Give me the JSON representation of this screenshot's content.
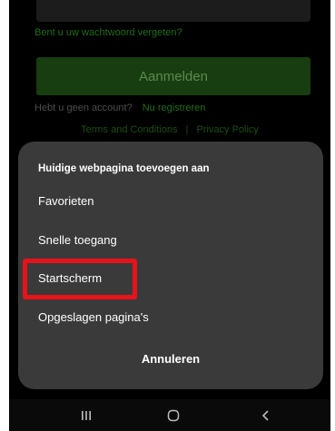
{
  "background": {
    "forgot_password_link": "Bent u uw wachtwoord vergeten?",
    "login_button": "Aanmelden",
    "no_account_text": "Hebt u geen account?",
    "register_link": "Nu registreren",
    "terms_link": "Terms and Conditions",
    "legal_separator": "|",
    "privacy_link": "Privacy Policy"
  },
  "sheet": {
    "title": "Huidige webpagina toevoegen aan",
    "items": [
      {
        "label": "Favorieten"
      },
      {
        "label": "Snelle toegang"
      },
      {
        "label": "Startscherm"
      },
      {
        "label": "Opgeslagen pagina's"
      }
    ],
    "cancel_label": "Annuleren"
  },
  "highlight": {
    "target": "Startscherm",
    "color": "#e8121a"
  },
  "navbar": {
    "recent_icon": "recent-apps-icon",
    "home_icon": "home-icon",
    "back_icon": "back-icon"
  },
  "colors": {
    "sheet_bg": "#3a3a3a",
    "screen_bg": "#000000",
    "accent_green": "#1f6e16"
  }
}
